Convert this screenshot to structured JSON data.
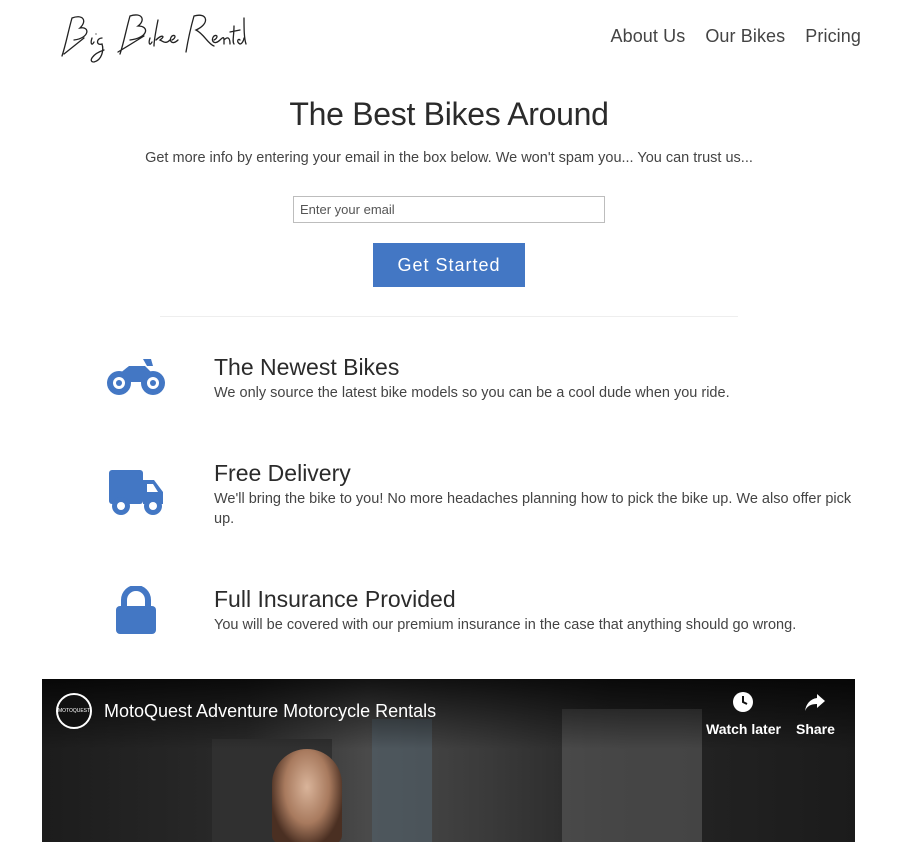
{
  "brand": {
    "logo_text": "Big Bike Rentals"
  },
  "nav": {
    "items": [
      "About Us",
      "Our Bikes",
      "Pricing"
    ]
  },
  "hero": {
    "title": "The Best Bikes Around",
    "subtitle": "Get more info by entering your email in the box below. We won't spam you... You can trust us...",
    "email_placeholder": "Enter your email",
    "cta_label": "Get Started"
  },
  "features": [
    {
      "icon": "motorcycle-icon",
      "title": "The Newest Bikes",
      "text": "We only source the latest bike models so you can be a cool dude when you ride."
    },
    {
      "icon": "truck-icon",
      "title": "Free Delivery",
      "text": "We'll bring the bike to you! No more headaches planning how to pick the bike up. We also offer pick up."
    },
    {
      "icon": "lock-icon",
      "title": "Full Insurance Provided",
      "text": "You will be covered with our premium insurance in the case that anything should go wrong."
    }
  ],
  "video": {
    "title": "MotoQuest Adventure Motorcycle Rentals",
    "channel_badge": "MOTOQUEST",
    "watch_later_label": "Watch later",
    "share_label": "Share"
  },
  "colors": {
    "accent": "#4377c4",
    "text": "#333333"
  }
}
